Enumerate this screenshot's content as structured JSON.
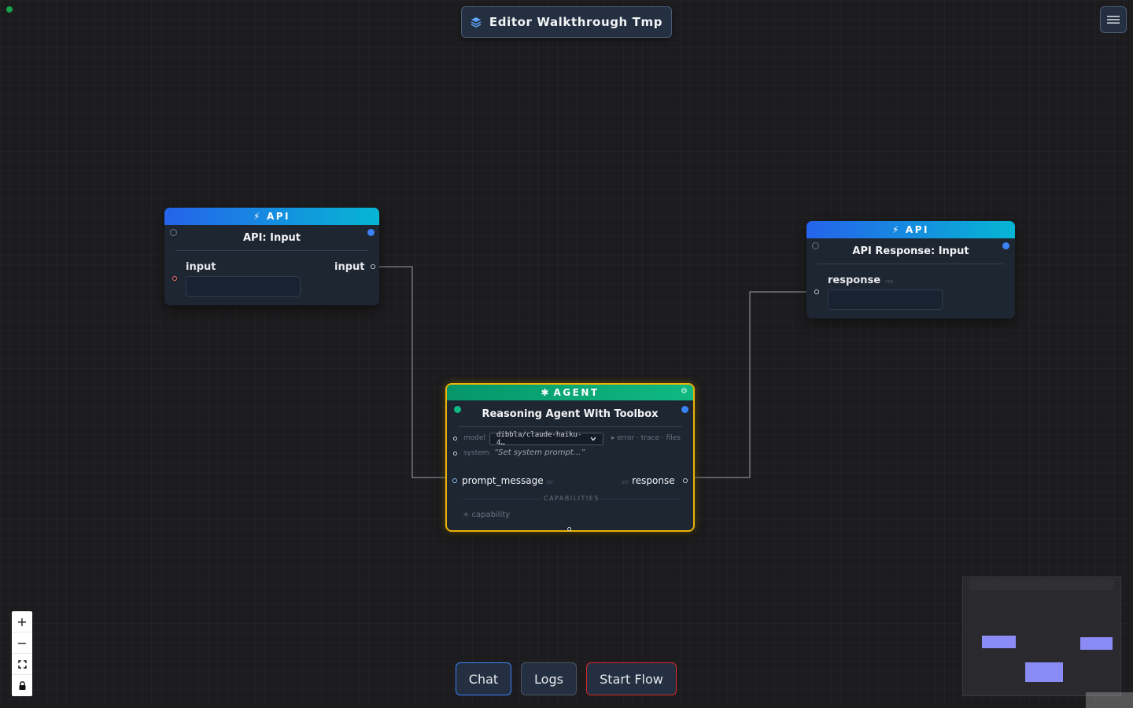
{
  "header": {
    "title": "Editor Walkthrough Tmp",
    "title_icon": "layers-icon",
    "menu_icon": "hamburger-menu-icon"
  },
  "nodes": {
    "api_input": {
      "category": "API",
      "category_icon": "lightning-icon",
      "title": "API: Input",
      "field_label": "input",
      "output_label": "input",
      "field_value": ""
    },
    "api_response": {
      "category": "API",
      "category_icon": "lightning-icon",
      "title": "API Response: Input",
      "field_label": "response",
      "field_type": "res",
      "field_value": ""
    },
    "agent": {
      "category": "AGENT",
      "category_icon": "agent-icon",
      "settings_icon": "gear-icon",
      "title": "Reasoning Agent With Toolbox",
      "model_label": "model",
      "model_value": "dibbla/claude-haiku-4…",
      "side_links": "▸ error · trace · files",
      "system_label": "system",
      "system_placeholder": "“Set system prompt...”",
      "input_port": "prompt_message",
      "input_type": "str",
      "output_port": "response",
      "output_type": "str",
      "capabilities_title": "CAPABILITIES",
      "add_capability": "+ capability"
    }
  },
  "zoom_controls": {
    "zoom_in": "+",
    "zoom_out": "−",
    "fit_icon": "fit-view-icon",
    "lock_icon": "lock-icon"
  },
  "toolbar": {
    "chat": "Chat",
    "logs": "Logs",
    "start_flow": "Start Flow"
  },
  "colors": {
    "api_header_start": "#2563eb",
    "api_header_end": "#06b6d4",
    "agent_header": "#10b981",
    "agent_border": "#eab308",
    "chat_border": "#3b82f6",
    "start_border": "#dc2626"
  }
}
